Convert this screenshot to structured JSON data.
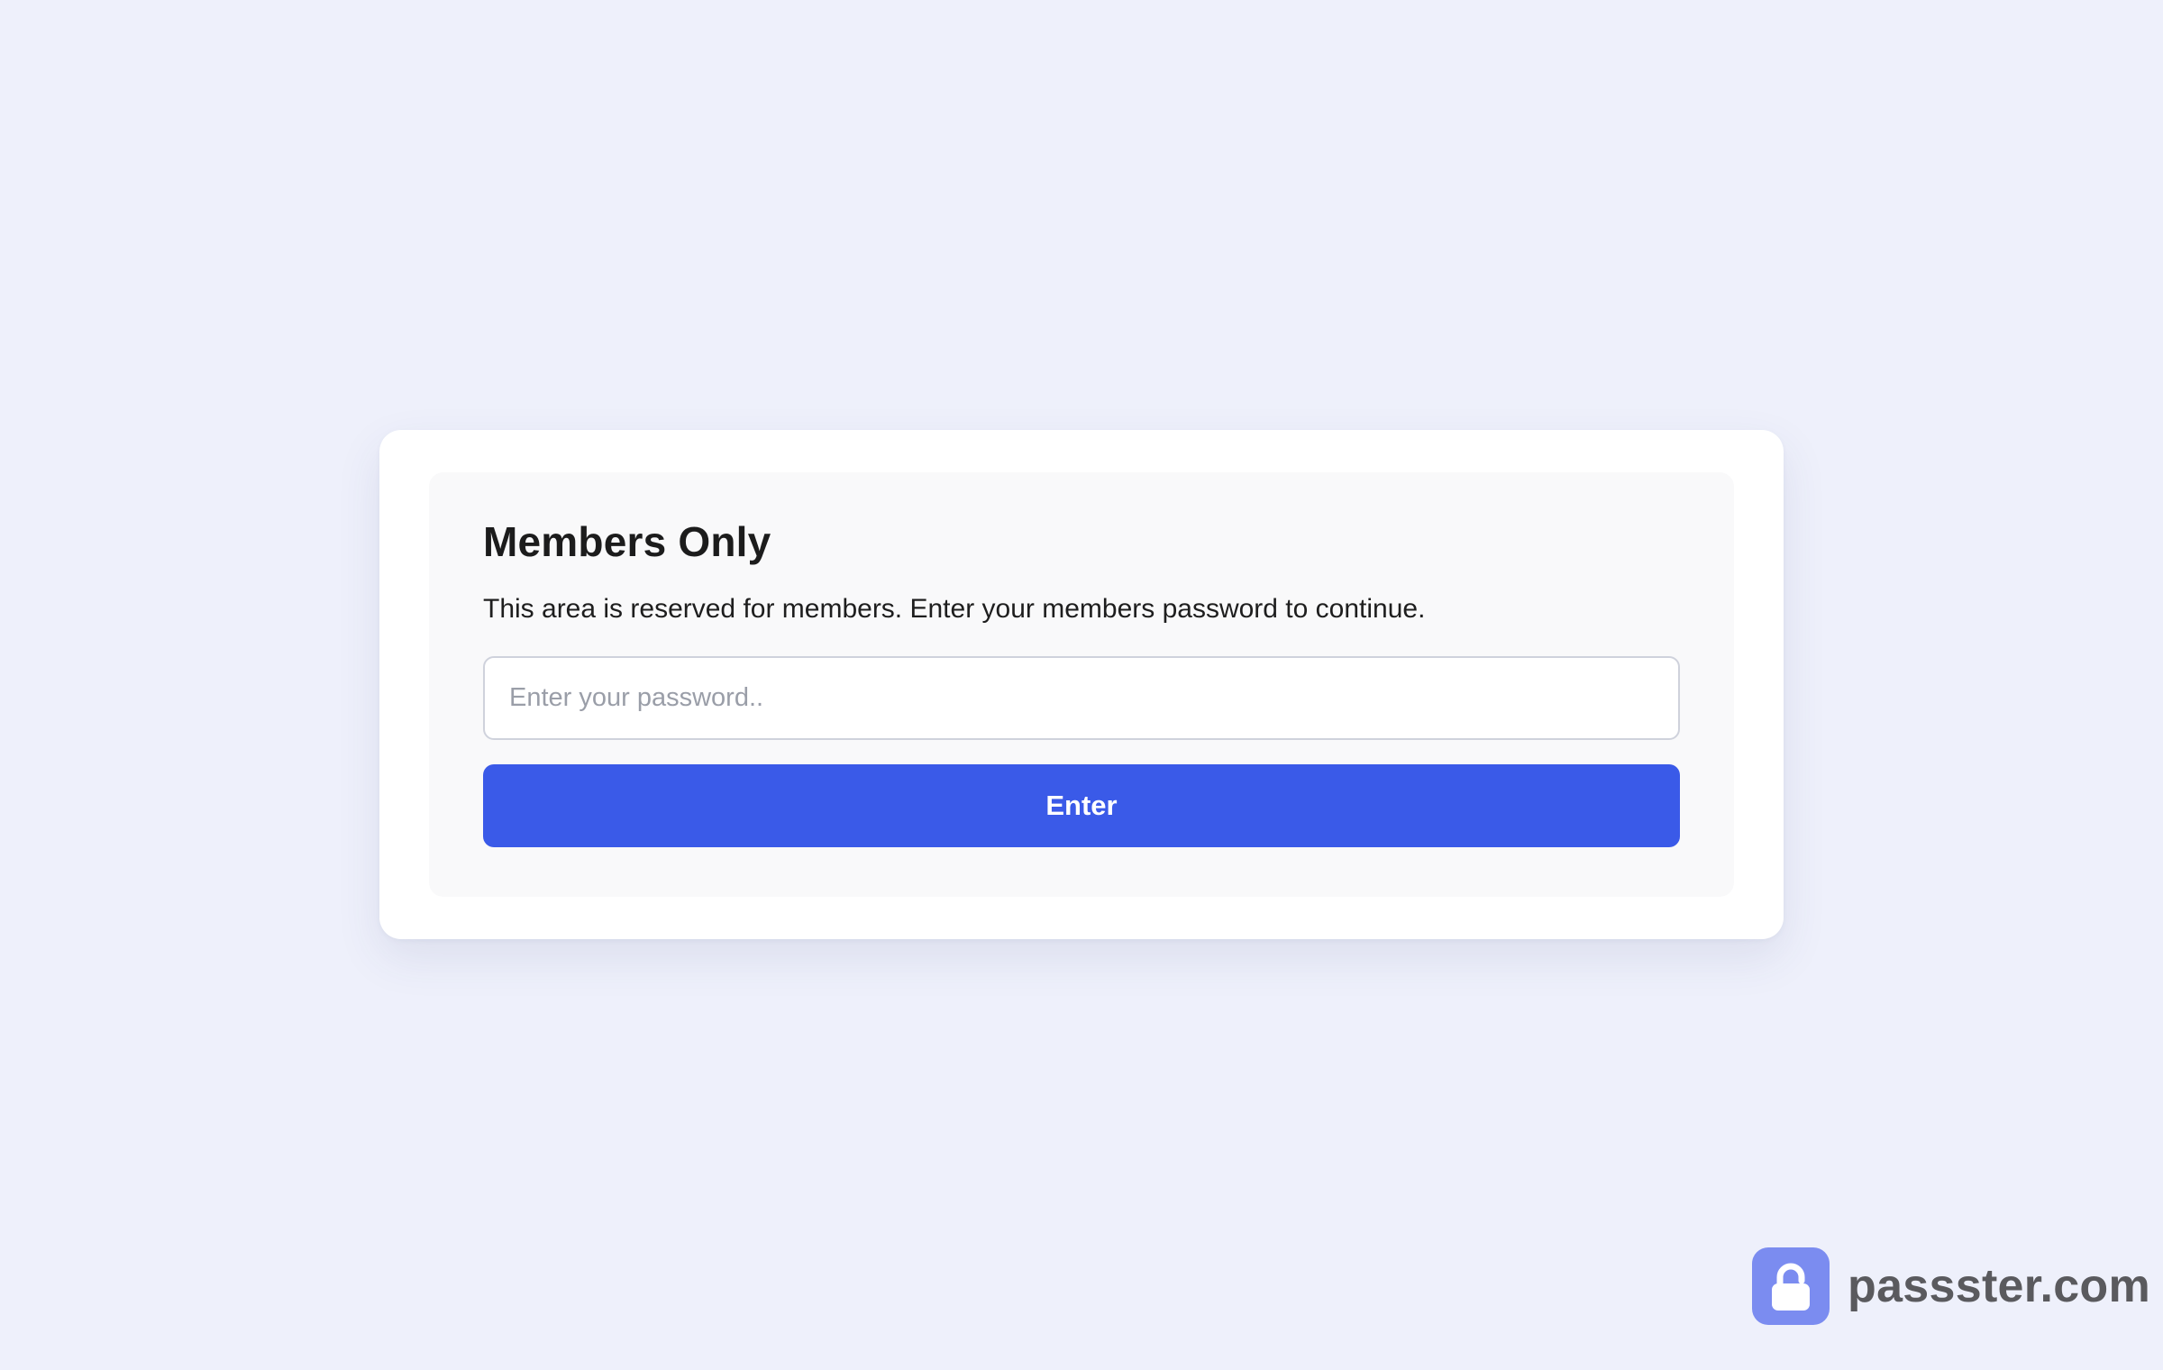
{
  "login": {
    "title": "Members Only",
    "description": "This area is reserved for members. Enter your members password to continue.",
    "password_placeholder": "Enter your password..",
    "password_value": "",
    "submit_label": "Enter"
  },
  "brand": {
    "name": "passster.com",
    "icon": "lock-icon"
  },
  "colors": {
    "background": "#eef0fb",
    "accent": "#3a5ae8",
    "brand_icon": "#7b8cf0"
  }
}
